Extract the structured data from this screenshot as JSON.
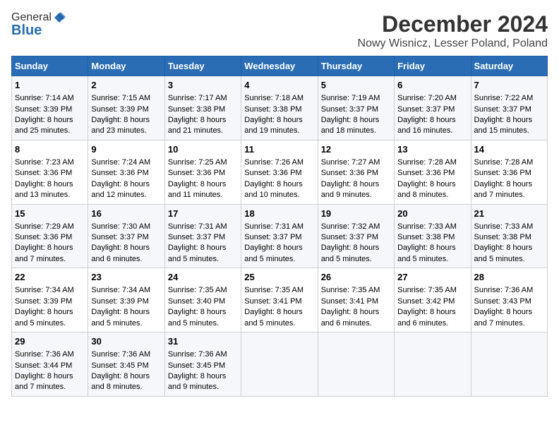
{
  "logo": {
    "general": "General",
    "blue": "Blue"
  },
  "title": "December 2024",
  "subtitle": "Nowy Wisnicz, Lesser Poland, Poland",
  "days_header": [
    "Sunday",
    "Monday",
    "Tuesday",
    "Wednesday",
    "Thursday",
    "Friday",
    "Saturday"
  ],
  "weeks": [
    [
      {
        "day": "1",
        "sunrise": "Sunrise: 7:14 AM",
        "sunset": "Sunset: 3:39 PM",
        "daylight": "Daylight: 8 hours and 25 minutes."
      },
      {
        "day": "2",
        "sunrise": "Sunrise: 7:15 AM",
        "sunset": "Sunset: 3:39 PM",
        "daylight": "Daylight: 8 hours and 23 minutes."
      },
      {
        "day": "3",
        "sunrise": "Sunrise: 7:17 AM",
        "sunset": "Sunset: 3:38 PM",
        "daylight": "Daylight: 8 hours and 21 minutes."
      },
      {
        "day": "4",
        "sunrise": "Sunrise: 7:18 AM",
        "sunset": "Sunset: 3:38 PM",
        "daylight": "Daylight: 8 hours and 19 minutes."
      },
      {
        "day": "5",
        "sunrise": "Sunrise: 7:19 AM",
        "sunset": "Sunset: 3:37 PM",
        "daylight": "Daylight: 8 hours and 18 minutes."
      },
      {
        "day": "6",
        "sunrise": "Sunrise: 7:20 AM",
        "sunset": "Sunset: 3:37 PM",
        "daylight": "Daylight: 8 hours and 16 minutes."
      },
      {
        "day": "7",
        "sunrise": "Sunrise: 7:22 AM",
        "sunset": "Sunset: 3:37 PM",
        "daylight": "Daylight: 8 hours and 15 minutes."
      }
    ],
    [
      {
        "day": "8",
        "sunrise": "Sunrise: 7:23 AM",
        "sunset": "Sunset: 3:36 PM",
        "daylight": "Daylight: 8 hours and 13 minutes."
      },
      {
        "day": "9",
        "sunrise": "Sunrise: 7:24 AM",
        "sunset": "Sunset: 3:36 PM",
        "daylight": "Daylight: 8 hours and 12 minutes."
      },
      {
        "day": "10",
        "sunrise": "Sunrise: 7:25 AM",
        "sunset": "Sunset: 3:36 PM",
        "daylight": "Daylight: 8 hours and 11 minutes."
      },
      {
        "day": "11",
        "sunrise": "Sunrise: 7:26 AM",
        "sunset": "Sunset: 3:36 PM",
        "daylight": "Daylight: 8 hours and 10 minutes."
      },
      {
        "day": "12",
        "sunrise": "Sunrise: 7:27 AM",
        "sunset": "Sunset: 3:36 PM",
        "daylight": "Daylight: 8 hours and 9 minutes."
      },
      {
        "day": "13",
        "sunrise": "Sunrise: 7:28 AM",
        "sunset": "Sunset: 3:36 PM",
        "daylight": "Daylight: 8 hours and 8 minutes."
      },
      {
        "day": "14",
        "sunrise": "Sunrise: 7:28 AM",
        "sunset": "Sunset: 3:36 PM",
        "daylight": "Daylight: 8 hours and 7 minutes."
      }
    ],
    [
      {
        "day": "15",
        "sunrise": "Sunrise: 7:29 AM",
        "sunset": "Sunset: 3:36 PM",
        "daylight": "Daylight: 8 hours and 7 minutes."
      },
      {
        "day": "16",
        "sunrise": "Sunrise: 7:30 AM",
        "sunset": "Sunset: 3:37 PM",
        "daylight": "Daylight: 8 hours and 6 minutes."
      },
      {
        "day": "17",
        "sunrise": "Sunrise: 7:31 AM",
        "sunset": "Sunset: 3:37 PM",
        "daylight": "Daylight: 8 hours and 5 minutes."
      },
      {
        "day": "18",
        "sunrise": "Sunrise: 7:31 AM",
        "sunset": "Sunset: 3:37 PM",
        "daylight": "Daylight: 8 hours and 5 minutes."
      },
      {
        "day": "19",
        "sunrise": "Sunrise: 7:32 AM",
        "sunset": "Sunset: 3:37 PM",
        "daylight": "Daylight: 8 hours and 5 minutes."
      },
      {
        "day": "20",
        "sunrise": "Sunrise: 7:33 AM",
        "sunset": "Sunset: 3:38 PM",
        "daylight": "Daylight: 8 hours and 5 minutes."
      },
      {
        "day": "21",
        "sunrise": "Sunrise: 7:33 AM",
        "sunset": "Sunset: 3:38 PM",
        "daylight": "Daylight: 8 hours and 5 minutes."
      }
    ],
    [
      {
        "day": "22",
        "sunrise": "Sunrise: 7:34 AM",
        "sunset": "Sunset: 3:39 PM",
        "daylight": "Daylight: 8 hours and 5 minutes."
      },
      {
        "day": "23",
        "sunrise": "Sunrise: 7:34 AM",
        "sunset": "Sunset: 3:39 PM",
        "daylight": "Daylight: 8 hours and 5 minutes."
      },
      {
        "day": "24",
        "sunrise": "Sunrise: 7:35 AM",
        "sunset": "Sunset: 3:40 PM",
        "daylight": "Daylight: 8 hours and 5 minutes."
      },
      {
        "day": "25",
        "sunrise": "Sunrise: 7:35 AM",
        "sunset": "Sunset: 3:41 PM",
        "daylight": "Daylight: 8 hours and 5 minutes."
      },
      {
        "day": "26",
        "sunrise": "Sunrise: 7:35 AM",
        "sunset": "Sunset: 3:41 PM",
        "daylight": "Daylight: 8 hours and 6 minutes."
      },
      {
        "day": "27",
        "sunrise": "Sunrise: 7:35 AM",
        "sunset": "Sunset: 3:42 PM",
        "daylight": "Daylight: 8 hours and 6 minutes."
      },
      {
        "day": "28",
        "sunrise": "Sunrise: 7:36 AM",
        "sunset": "Sunset: 3:43 PM",
        "daylight": "Daylight: 8 hours and 7 minutes."
      }
    ],
    [
      {
        "day": "29",
        "sunrise": "Sunrise: 7:36 AM",
        "sunset": "Sunset: 3:44 PM",
        "daylight": "Daylight: 8 hours and 7 minutes."
      },
      {
        "day": "30",
        "sunrise": "Sunrise: 7:36 AM",
        "sunset": "Sunset: 3:45 PM",
        "daylight": "Daylight: 8 hours and 8 minutes."
      },
      {
        "day": "31",
        "sunrise": "Sunrise: 7:36 AM",
        "sunset": "Sunset: 3:45 PM",
        "daylight": "Daylight: 8 hours and 9 minutes."
      },
      null,
      null,
      null,
      null
    ]
  ]
}
